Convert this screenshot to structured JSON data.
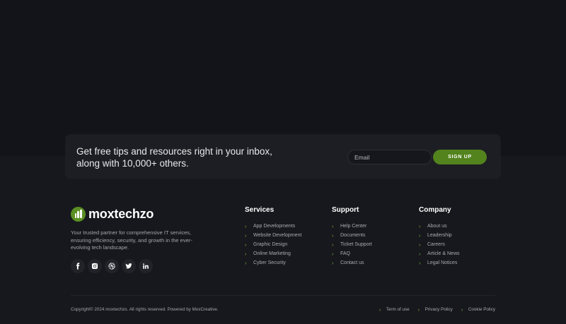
{
  "newsletter": {
    "line1": "Get free tips and resources right in your inbox,",
    "line2": "along with 10,000+ others.",
    "email_placeholder": "Email",
    "signup_label": "SIGN UP"
  },
  "brand": {
    "name": "moxtechzo",
    "tagline": "Your trusted partner for comprehensive IT services, ensuring efficiency, security, and growth in the ever-evolving tech landscape.",
    "socials": [
      "facebook-icon",
      "instagram-icon",
      "dribbble-icon",
      "twitter-icon",
      "linkedin-icon"
    ]
  },
  "columns": {
    "services": {
      "title": "Services",
      "items": [
        "App Developments",
        "Website Development",
        "Graphic Design",
        "Online Marketing",
        "Cyber Security"
      ]
    },
    "support": {
      "title": "Support",
      "items": [
        "Help Center",
        "Documents",
        "Ticket Support",
        "FAQ",
        "Contact us"
      ]
    },
    "company": {
      "title": "Company",
      "items": [
        "About us",
        "Leadership",
        "Careers",
        "Article & News",
        "Legal Notices"
      ]
    }
  },
  "footer": {
    "copyright": "Copyright© 2024 moxtechzo. All rights reserved. Powered by MoxCreative.",
    "links": [
      "Term of use",
      "Privacy Policy",
      "Cookie Policy"
    ]
  },
  "colors": {
    "accent": "#52831d",
    "chevron": "#6fb52c",
    "background": "#131419"
  }
}
